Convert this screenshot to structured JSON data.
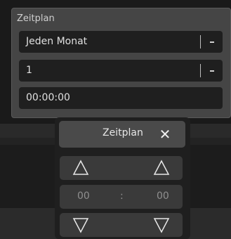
{
  "panel": {
    "title": "Zeitplan",
    "frequency": {
      "value": "Jeden Monat"
    },
    "day": {
      "value": "1"
    },
    "time": {
      "value": "00:00:00"
    }
  },
  "picker": {
    "title": "Zeitplan",
    "close_glyph": "✕",
    "hour": "00",
    "separator": ":",
    "minute": "00",
    "icons": {
      "close": "close-icon",
      "up": "triangle-up-icon",
      "down": "triangle-down-icon",
      "dropdown": "dropdown-dash-icon"
    }
  }
}
